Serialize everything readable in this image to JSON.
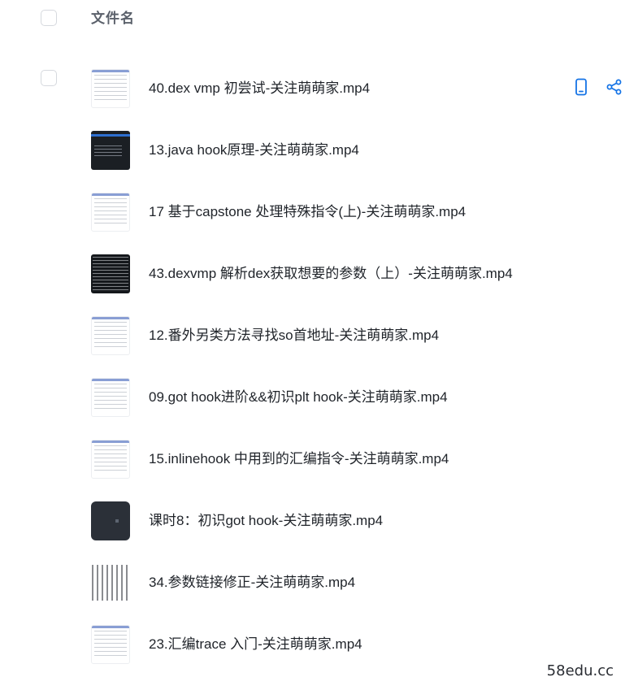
{
  "header": {
    "title": "文件名"
  },
  "files": [
    {
      "name": "40.dex vmp 初尝试-关注萌萌家.mp4"
    },
    {
      "name": "13.java hook原理-关注萌萌家.mp4"
    },
    {
      "name": "17 基于capstone 处理特殊指令(上)-关注萌萌家.mp4"
    },
    {
      "name": "43.dexvmp 解析dex获取想要的参数（上）-关注萌萌家.mp4"
    },
    {
      "name": "12.番外另类方法寻找so首地址-关注萌萌家.mp4"
    },
    {
      "name": "09.got hook进阶&&初识plt hook-关注萌萌家.mp4"
    },
    {
      "name": "15.inlinehook 中用到的汇编指令-关注萌萌家.mp4"
    },
    {
      "name": "课时8：初识got hook-关注萌萌家.mp4"
    },
    {
      "name": "34.参数链接修正-关注萌萌家.mp4"
    },
    {
      "name": "23.汇编trace 入门-关注萌萌家.mp4"
    }
  ],
  "icons": {
    "phone": "phone-icon",
    "share": "share-icon",
    "accent_color": "#1473e6"
  },
  "watermark": "58edu.cc"
}
